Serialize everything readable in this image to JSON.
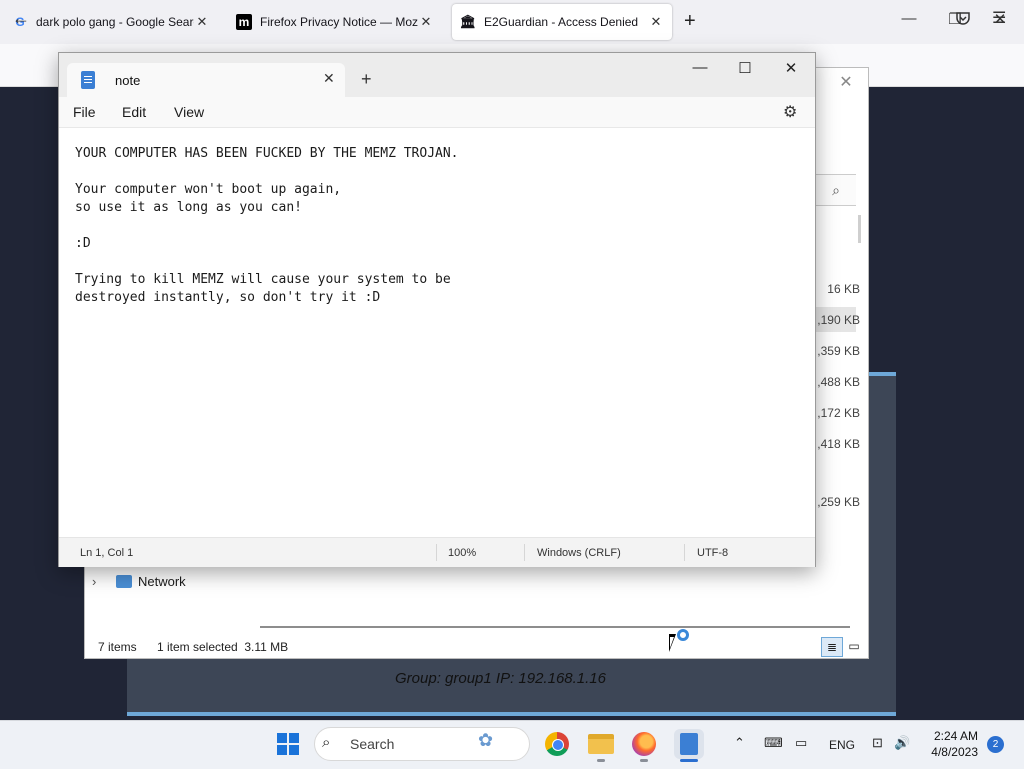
{
  "browser": {
    "tabs": [
      {
        "favicon": "G",
        "title": "dark polo gang - Google Search",
        "close": "✕"
      },
      {
        "favicon": "m",
        "title": "Firefox Privacy Notice — Mozil",
        "close": "✕"
      },
      {
        "favicon": "🏛",
        "title": "E2Guardian - Access Denied",
        "close": "✕"
      }
    ],
    "new_tab": "+",
    "window_controls": {
      "minimize": "—",
      "restore": "❐",
      "close": "✕"
    },
    "back": "←",
    "pocket_icon": "pocket-icon",
    "menu_icon": "☰"
  },
  "blocked_page": {
    "group_line": "Group: group1   IP: 192.168.1.16"
  },
  "explorer": {
    "close": "✕",
    "search_icon": "⌕",
    "sizes": [
      "16 KB",
      ",190 KB",
      ",359 KB",
      ",488 KB",
      ",172 KB",
      ",418 KB",
      ",259 KB"
    ],
    "selected_index": 1,
    "nav_network_chevron": "›",
    "nav_network_label": "Network",
    "status_items": "7 items",
    "status_selected": "1 item selected  3.11 MB",
    "view_details": "≣",
    "view_tiles": "▭"
  },
  "notepad": {
    "tab_title": "note",
    "tab_close": "✕",
    "new_tab": "+",
    "window_controls": {
      "minimize": "—",
      "maximize": "☐",
      "close": "✕"
    },
    "menu": {
      "file": "File",
      "edit": "Edit",
      "view": "View"
    },
    "settings_icon": "⚙",
    "content": "YOUR COMPUTER HAS BEEN FUCKED BY THE MEMZ TROJAN.\n\nYour computer won't boot up again,\nso use it as long as you can!\n\n:D\n\nTrying to kill MEMZ will cause your system to be\ndestroyed instantly, so don't try it :D",
    "status": {
      "position": "Ln 1, Col 1",
      "zoom": "100%",
      "line_ending": "Windows (CRLF)",
      "encoding": "UTF-8"
    }
  },
  "taskbar": {
    "search_icon": "⌕",
    "search_label": "Search",
    "search_art": "✿",
    "tray_chevron": "⌃",
    "keyboard_icon": "⌨",
    "tablet_icon": "▭",
    "language": "ENG",
    "network_icon": "⊡",
    "volume_icon": "🔊",
    "time": "2:24 AM",
    "date": "4/8/2023",
    "notifications": "2"
  },
  "colors": {
    "accent": "#2b6fd0",
    "e2guardian_border": "#6ea8d8",
    "e2guardian_bg": "#3d4656"
  }
}
